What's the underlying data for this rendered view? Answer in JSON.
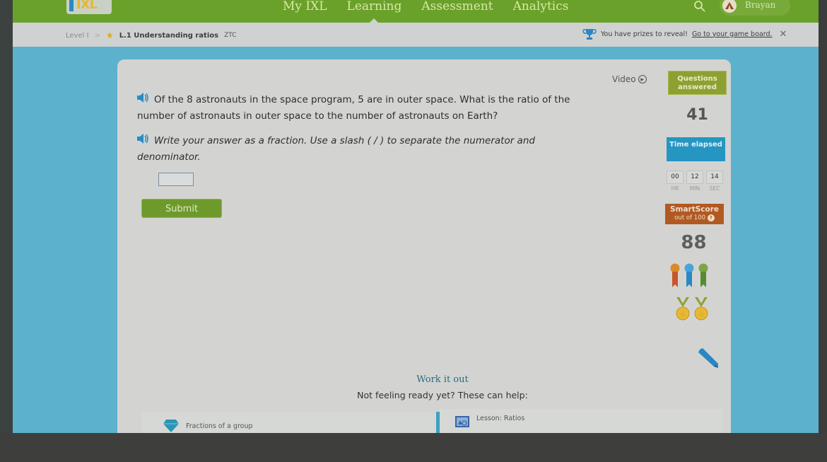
{
  "nav": {
    "logo": "IXL",
    "items": [
      "My IXL",
      "Learning",
      "Assessment",
      "Analytics"
    ],
    "active": "Learning",
    "user": "Brayan"
  },
  "breadcrumb": {
    "level": "Level I",
    "separator": ">",
    "skill": "L.1 Understanding ratios",
    "code": "ZTC"
  },
  "prize_banner": {
    "text": "You have prizes to reveal!",
    "link": "Go to your game board.",
    "close": "✕"
  },
  "question": {
    "text": "Of the 8 astronauts in the space program, 5 are in outer space. What is the ratio of the number of astronauts in outer space to the number of astronauts on Earth?",
    "instruction": "Write your answer as a fraction. Use a slash ( / ) to separate the numerator and denominator.",
    "answer_value": "",
    "submit_label": "Submit"
  },
  "sidebar": {
    "video_label": "Video",
    "questions_answered_label": "Questions answered",
    "questions_answered_value": "41",
    "time_elapsed_label": "Time elapsed",
    "time": [
      {
        "value": "00",
        "unit": "HR"
      },
      {
        "value": "12",
        "unit": "MIN"
      },
      {
        "value": "14",
        "unit": "SEC"
      }
    ],
    "smartscore_label": "SmartScore",
    "smartscore_sub": "out of 100",
    "smartscore_value": "88",
    "ribbon_colors": [
      "#c8562a",
      "#2a86c4",
      "#6a9a34"
    ],
    "medal_count": 2
  },
  "help": {
    "title": "Work it out",
    "subtitle": "Not feeling ready yet? These can help:",
    "items": [
      {
        "icon": "diamond-icon",
        "label": "Fractions of a group"
      },
      {
        "icon": "lesson-icon",
        "label": "Lesson: Ratios"
      }
    ]
  },
  "colors": {
    "nav_green": "#6aa12a",
    "questions_box": "#8fa033",
    "time_box": "#2596c2",
    "smartscore_box": "#b05a22",
    "background_blue": "#5cb2cc"
  }
}
